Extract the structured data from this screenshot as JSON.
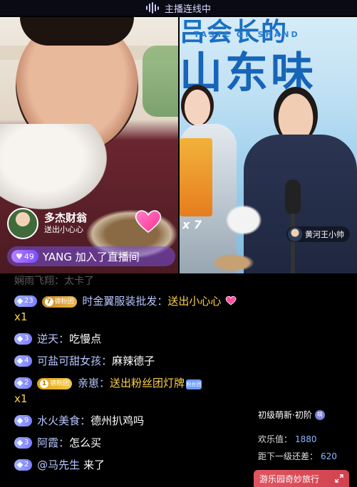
{
  "status": {
    "title": "主播连线中"
  },
  "stream_left": {
    "host_name": "多杰财翁",
    "host_sub": "送出小心心",
    "join_notice": {
      "level": "49",
      "text": "YANG 加入了直播间"
    }
  },
  "stream_right": {
    "banner_top": "吕会长的",
    "banner_en": "TASTE OF SHAND",
    "banner_main": "山东味",
    "gift_count": "x 7",
    "guest_name": "黄河王小帅"
  },
  "faded_line": "娴雨飞翔：太卡了",
  "chat": [
    {
      "level": "23",
      "fan_level": "7",
      "fan_label": "德粉团",
      "user": "时金翼服装批发：",
      "content": "送出小心心",
      "suffix": "x1",
      "gift": true
    },
    {
      "level": "3",
      "user": "逆天：",
      "content": "吃慢点"
    },
    {
      "level": "4",
      "user": "可盐可甜女孩：",
      "content": "麻辣德子"
    },
    {
      "level": "2",
      "fan_level": "1",
      "fan_label": "德粉团",
      "user": "亲崽：",
      "content": "送出粉丝团灯牌",
      "suffix": "x1",
      "gift": true,
      "lamp": "粉丝团"
    },
    {
      "level": "9",
      "user": "水火美食：",
      "content": "德州扒鸡吗"
    },
    {
      "level": "3",
      "user": "阿霞：",
      "content": "怎么买"
    },
    {
      "level": "2",
      "user": "@马先生",
      "content": " 来了"
    }
  ],
  "rank_panel": {
    "title": "初级萌新·初阶",
    "badge": "萌",
    "joy_label": "欢乐值：",
    "joy_value": "1880",
    "next_label": "距下一级还差：",
    "next_value": "620"
  },
  "promo": {
    "text": "游乐园奇妙旅行",
    "icon": "expand-icon"
  },
  "colors": {
    "username": "#b8c6ff",
    "gift": "#ffd24a",
    "promo": "#e05561"
  }
}
